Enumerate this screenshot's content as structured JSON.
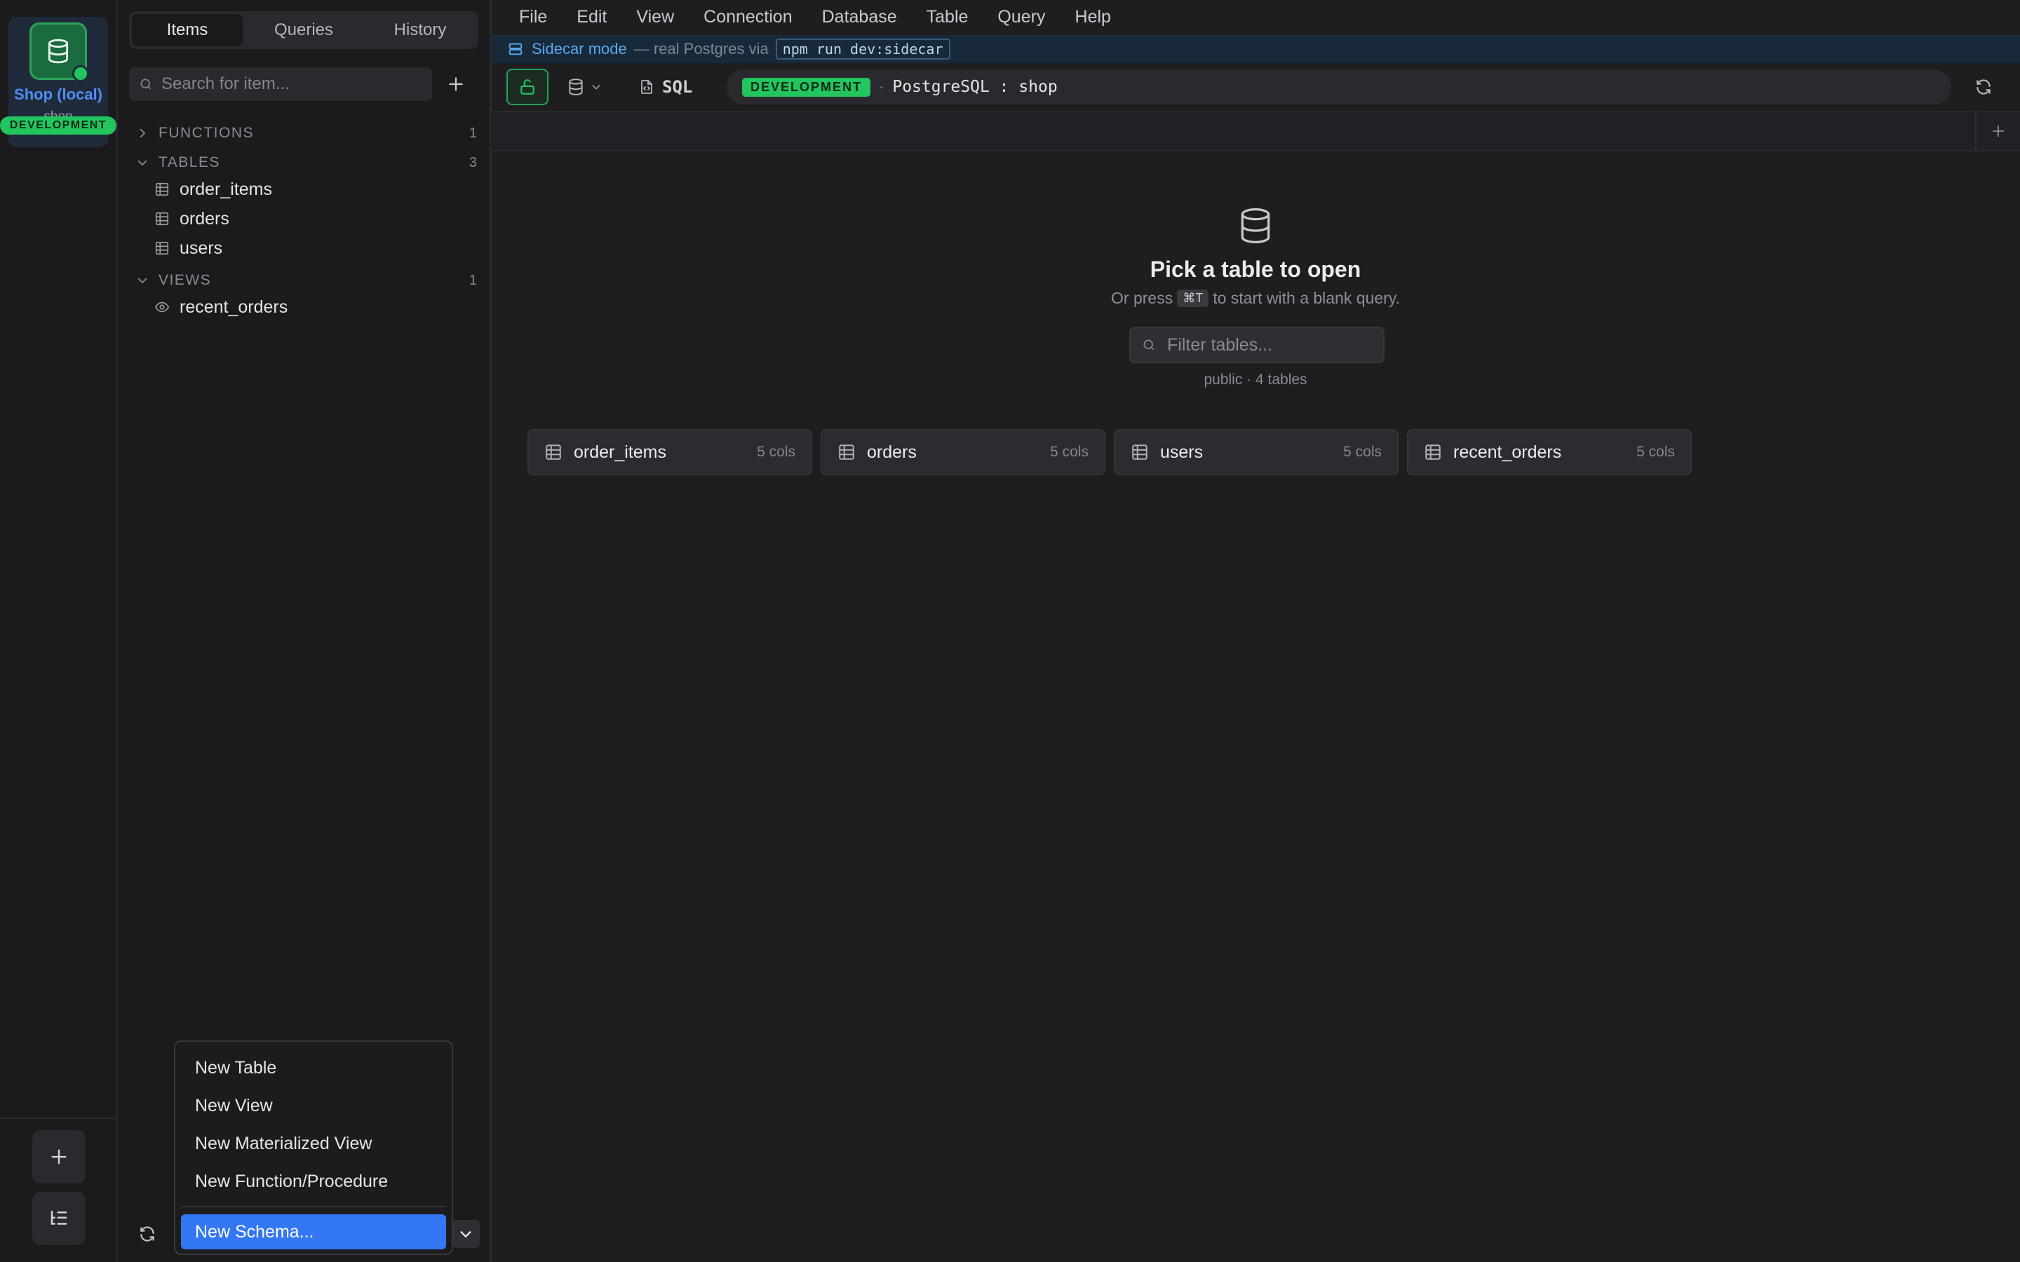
{
  "connection": {
    "name": "Shop (local)",
    "database": "shop",
    "environment": "DEVELOPMENT",
    "status_color": "#22c55e"
  },
  "sidebar": {
    "tabs": [
      {
        "label": "Items",
        "active": true
      },
      {
        "label": "Queries",
        "active": false
      },
      {
        "label": "History",
        "active": false
      }
    ],
    "search_placeholder": "Search for item...",
    "groups": {
      "functions": {
        "label": "FUNCTIONS",
        "count": "1",
        "expanded": false
      },
      "tables": {
        "label": "TABLES",
        "count": "3",
        "expanded": true
      },
      "views": {
        "label": "VIEWS",
        "count": "1",
        "expanded": true
      }
    },
    "tables": [
      "order_items",
      "orders",
      "users"
    ],
    "views": [
      "recent_orders"
    ]
  },
  "menubar": [
    "File",
    "Edit",
    "View",
    "Connection",
    "Database",
    "Table",
    "Query",
    "Help"
  ],
  "banner": {
    "title": "Sidecar mode",
    "text": "— real Postgres via",
    "command": "npm run dev:sidecar"
  },
  "toolbar": {
    "sql_label": "SQL",
    "env_badge": "DEVELOPMENT",
    "separator": "·",
    "connection_string": "PostgreSQL : shop"
  },
  "empty_state": {
    "title": "Pick a table to open",
    "subtitle_prefix": "Or press",
    "shortcut": "⌘T",
    "subtitle_suffix": "to start with a blank query.",
    "filter_placeholder": "Filter tables...",
    "schema_info": "public · 4 tables"
  },
  "table_cards": [
    {
      "name": "order_items",
      "cols": "5 cols"
    },
    {
      "name": "orders",
      "cols": "5 cols"
    },
    {
      "name": "users",
      "cols": "5 cols"
    },
    {
      "name": "recent_orders",
      "cols": "5 cols"
    }
  ],
  "dropdown_menu": {
    "items": [
      "New Table",
      "New View",
      "New Materialized View",
      "New Function/Procedure"
    ],
    "highlighted": "New Schema...",
    "highlight_color": "#3477f5"
  },
  "icons": [
    "database-icon",
    "plus-icon",
    "list-tree-icon",
    "chevron-right-icon",
    "chevron-down-icon",
    "table-icon",
    "eye-icon",
    "search-icon",
    "refresh-icon",
    "lock-open-icon",
    "file-code-icon",
    "server-icon"
  ]
}
